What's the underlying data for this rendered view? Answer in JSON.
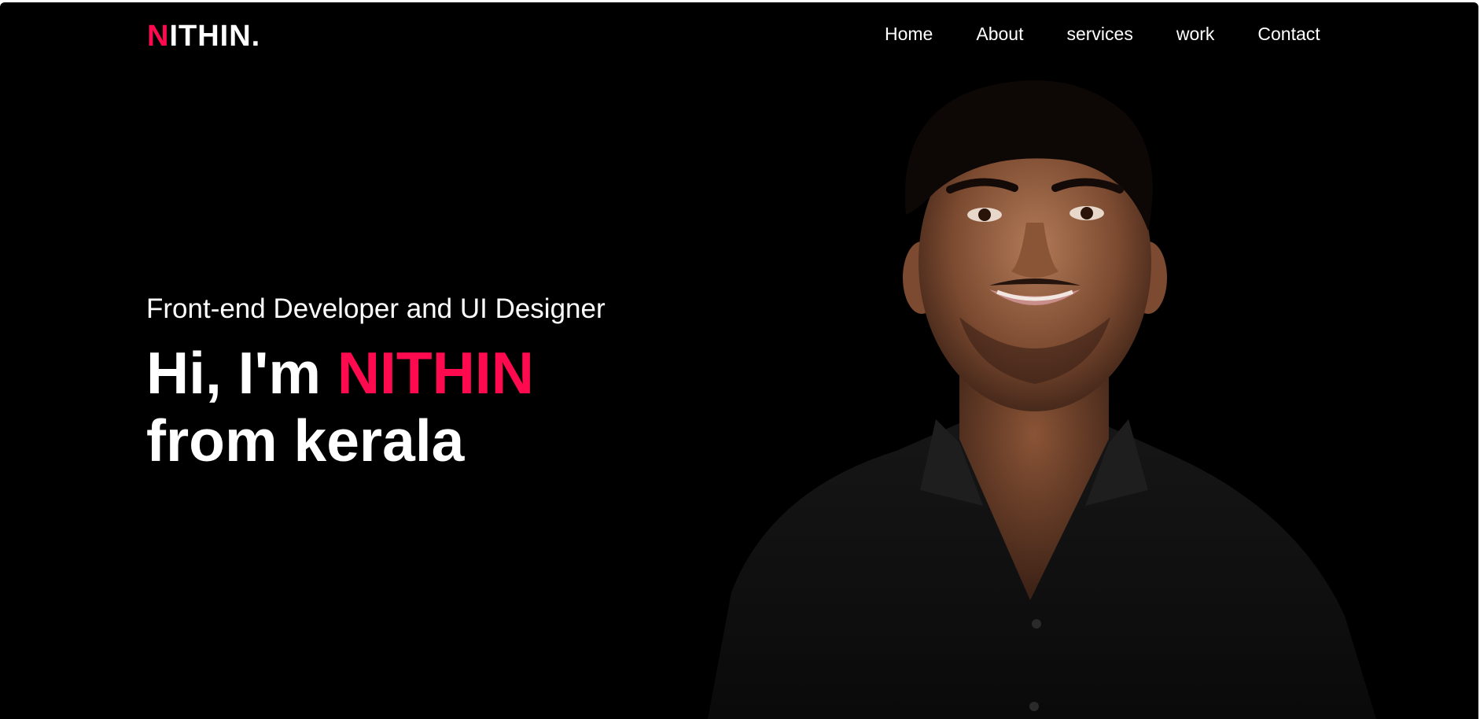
{
  "colors": {
    "background": "#000000",
    "text": "#ffffff",
    "accent": "#ff0a4e"
  },
  "logo": {
    "first_letter": "N",
    "rest": "ITHIN."
  },
  "nav": {
    "links": [
      "Home",
      "About",
      "services",
      "work",
      "Contact"
    ]
  },
  "hero": {
    "subtitle": "Front-end Developer and UI Designer",
    "greeting": "Hi, I'm",
    "name": "NITHIN",
    "line2": "from kerala"
  },
  "portrait": {
    "icon": "person-photo"
  }
}
